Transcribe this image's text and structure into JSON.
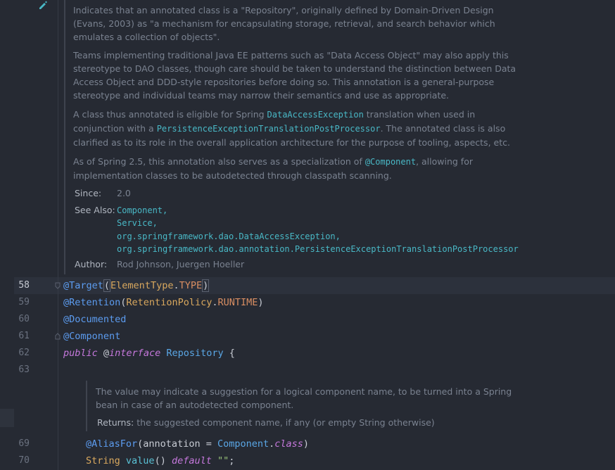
{
  "doc_main": {
    "p1": "Indicates that an annotated class is a \"Repository\", originally defined by Domain-Driven Design (Evans, 2003) as \"a mechanism for encapsulating storage, retrieval, and search behavior which emulates a collection of objects\".",
    "p2": "Teams implementing traditional Java EE patterns such as \"Data Access Object\" may also apply this stereotype to DAO classes, though care should be taken to understand the distinction between Data Access Object and DDD-style repositories before doing so. This annotation is a general-purpose stereotype and individual teams may narrow their semantics and use as appropriate.",
    "p3_a": "A class thus annotated is eligible for Spring ",
    "p3_code1": "DataAccessException",
    "p3_b": " translation when used in conjunction with a ",
    "p3_code2": "PersistenceExceptionTranslationPostProcessor",
    "p3_c": ". The annotated class is also clarified as to its role in the overall application architecture for the purpose of tooling, aspects, etc.",
    "p4_a": "As of Spring 2.5, this annotation also serves as a specialization of ",
    "p4_code": "@Component",
    "p4_b": ", allowing for implementation classes to be autodetected through classpath scanning.",
    "since_label": "Since:",
    "since_value": "2.0",
    "see_also_label": "See Also:",
    "see_also": [
      "Component,",
      "Service,",
      "org.springframework.dao.DataAccessException,",
      "org.springframework.dao.annotation.PersistenceExceptionTranslationPostProcessor"
    ],
    "author_label": "Author:",
    "author_value": "Rod Johnson, Juergen Hoeller"
  },
  "line_numbers": [
    "58",
    "59",
    "60",
    "61",
    "62",
    "63",
    "69",
    "70"
  ],
  "code": {
    "l58_ann": "@Target",
    "l58_open": "(",
    "l58_cls": "ElementType",
    "l58_dot": ".",
    "l58_const": "TYPE",
    "l58_close": ")",
    "l59_ann": "@Retention",
    "l59_open": "(",
    "l59_cls": "RetentionPolicy",
    "l59_dot": ".",
    "l59_const": "RUNTIME",
    "l59_close": ")",
    "l60_ann": "@Documented",
    "l61_ann": "@Component",
    "l62_kw": "public",
    "l62_at": " @",
    "l62_iface_kw": "interface",
    "l62_name": "Repository",
    "l62_brace": " {",
    "l69_ann": "@AliasFor",
    "l69_open": "(",
    "l69_param": "annotation = ",
    "l69_cls": "Component",
    "l69_dot": ".",
    "l69_kw": "class",
    "l69_close": ")",
    "l70_type": "String",
    "l70_fn": "value",
    "l70_paren": "() ",
    "l70_kw": "default",
    "l70_str": "\"\"",
    "l70_semi": ";"
  },
  "doc_value": {
    "p1": "The value may indicate a suggestion for a logical component name, to be turned into a Spring bean in case of an autodetected component.",
    "returns_label": "Returns:",
    "returns_value": "the suggested component name, if any (or empty String otherwise)"
  },
  "colors": {
    "background": "#262a33",
    "annotation": "#5c9cf0",
    "keyword": "#c678dd",
    "class": "#d9a85e",
    "constant": "#d98e62",
    "doc_text": "#7a8290",
    "doc_code": "#49b8c6"
  },
  "icons": {
    "edit": "pencil-icon",
    "fold": "fold-icon"
  }
}
